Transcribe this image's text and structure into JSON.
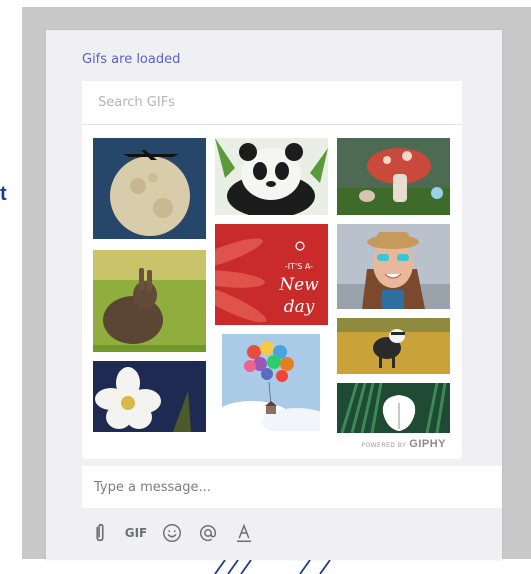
{
  "backdrop": {
    "edge_text": "t"
  },
  "panel": {
    "status_text": "Gifs are loaded",
    "search": {
      "placeholder": "Search GIFs",
      "value": ""
    },
    "gifs": [
      {
        "icon": "moon-airplane-gif"
      },
      {
        "icon": "panda-gif"
      },
      {
        "icon": "mushroom-gif"
      },
      {
        "icon": "rabbit-gif"
      },
      {
        "icon": "new-day-gif",
        "text_top": "-IT'S A-",
        "text_mid": "New",
        "text_bot": "day"
      },
      {
        "icon": "smiling-woman-gif"
      },
      {
        "icon": "goat-gif"
      },
      {
        "icon": "balloon-house-gif"
      },
      {
        "icon": "white-flower-gif"
      },
      {
        "icon": "green-leaves-gif"
      }
    ],
    "giphy": {
      "powered": "POWERED BY",
      "brand": "GIPHY"
    },
    "message": {
      "placeholder": "Type a message...",
      "value": ""
    },
    "toolbar": {
      "gif_label": "GIF"
    }
  },
  "colors": {
    "accent": "#5b5fc7",
    "panel_bg": "#f0f0f3",
    "frame_bg": "#c8c8c8",
    "icon": "#6e6e78"
  }
}
